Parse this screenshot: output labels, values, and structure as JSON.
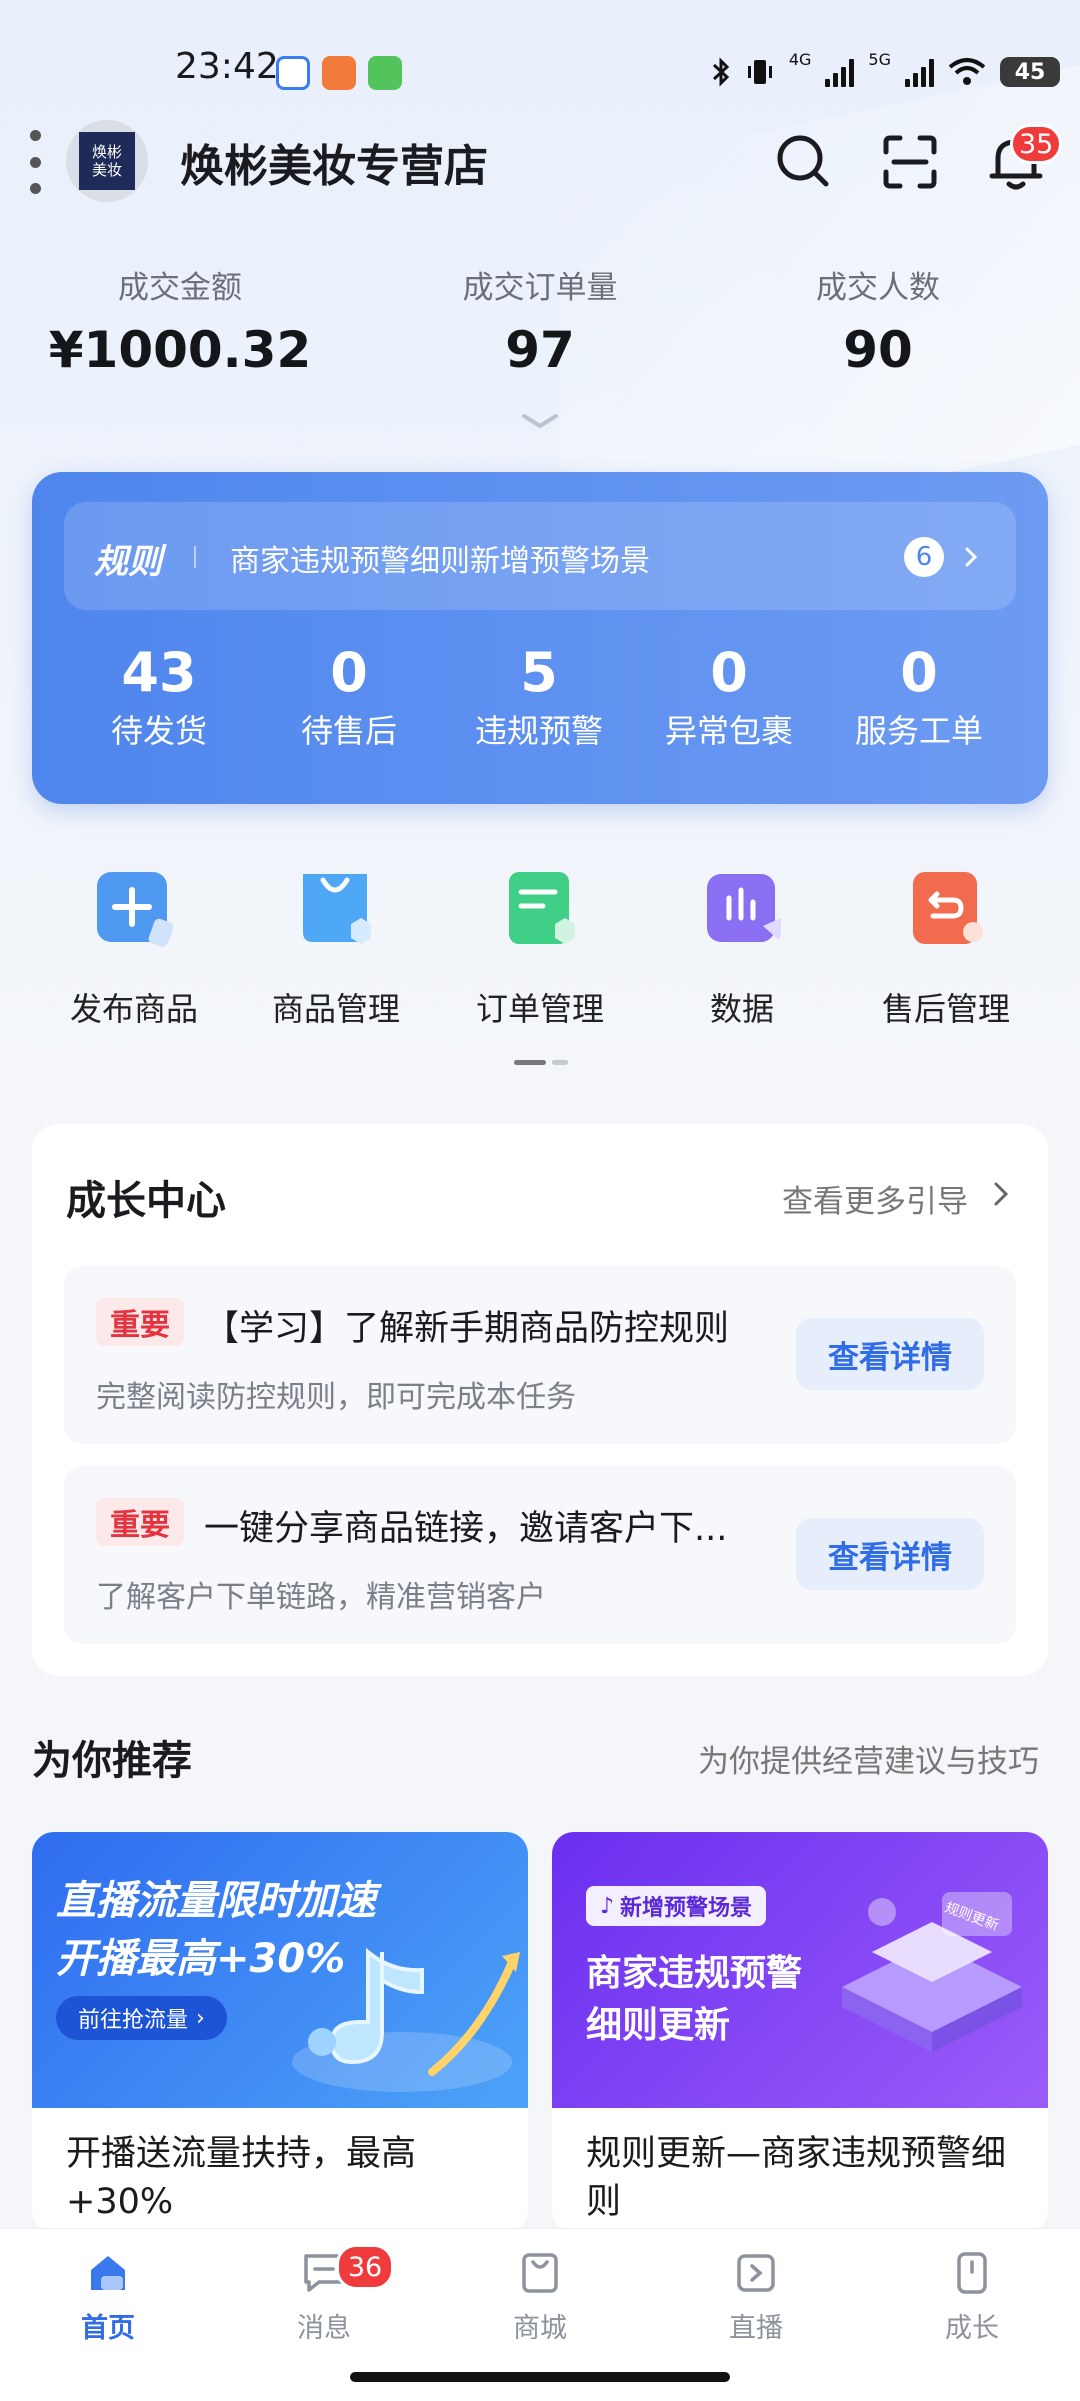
{
  "status_bar": {
    "time": "23:42",
    "network_1": "4G",
    "network_2": "5G",
    "battery": "45"
  },
  "header": {
    "logo_text": "焕彬美妆",
    "store_name": "焕彬美妆专营店",
    "notification_count": "35"
  },
  "stats": [
    {
      "label": "成交金额",
      "value": "¥1000.32"
    },
    {
      "label": "成交订单量",
      "value": "97"
    },
    {
      "label": "成交人数",
      "value": "90"
    }
  ],
  "rules": {
    "tag": "规则",
    "text": "商家违规预警细则新增预警场景",
    "count": "6"
  },
  "metrics": [
    {
      "value": "43",
      "label": "待发货"
    },
    {
      "value": "0",
      "label": "待售后"
    },
    {
      "value": "5",
      "label": "违规预警"
    },
    {
      "value": "0",
      "label": "异常包裹"
    },
    {
      "value": "0",
      "label": "服务工单"
    }
  ],
  "quick_actions": [
    {
      "label": "发布商品",
      "icon": "plus-icon",
      "color": "#4f9af0"
    },
    {
      "label": "商品管理",
      "icon": "bag-icon",
      "color": "#4fa8f5"
    },
    {
      "label": "订单管理",
      "icon": "document-icon",
      "color": "#3fcf86"
    },
    {
      "label": "数据",
      "icon": "chart-icon",
      "color": "#8a6ff3"
    },
    {
      "label": "售后管理",
      "icon": "return-icon",
      "color": "#f26b4e"
    }
  ],
  "growth": {
    "title": "成长中心",
    "more": "查看更多引导",
    "tasks": [
      {
        "tag": "重要",
        "title": "【学习】了解新手期商品防控规则",
        "subtitle": "完整阅读防控规则，即可完成本任务",
        "button": "查看详情"
      },
      {
        "tag": "重要",
        "title": "一键分享商品链接，邀请客户下...",
        "subtitle": "了解客户下单链路，精准营销客户",
        "button": "查看详情"
      }
    ]
  },
  "recommend": {
    "title": "为你推荐",
    "subtitle": "为你提供经营建议与技巧",
    "cards": [
      {
        "banner_line1": "直播流量限时加速",
        "banner_line2": "开播最高+30%",
        "banner_button": "前往抢流量",
        "caption": "开播送流量扶持，最高+30%"
      },
      {
        "banner_tag": "新增预警场景",
        "banner_line1": "商家违规预警",
        "banner_line2": "细则更新",
        "banner_badge": "规则更新",
        "caption": "规则更新—商家违规预警细则"
      }
    ]
  },
  "tabs": [
    {
      "label": "首页",
      "icon": "home-icon"
    },
    {
      "label": "消息",
      "icon": "message-icon",
      "badge": "36"
    },
    {
      "label": "商城",
      "icon": "shop-icon"
    },
    {
      "label": "直播",
      "icon": "live-icon"
    },
    {
      "label": "成长",
      "icon": "growth-icon"
    }
  ],
  "colors": {
    "accent": "#2f6ce5",
    "card_blue": "#5a8ef0",
    "badge_red": "#ef3b3b"
  }
}
